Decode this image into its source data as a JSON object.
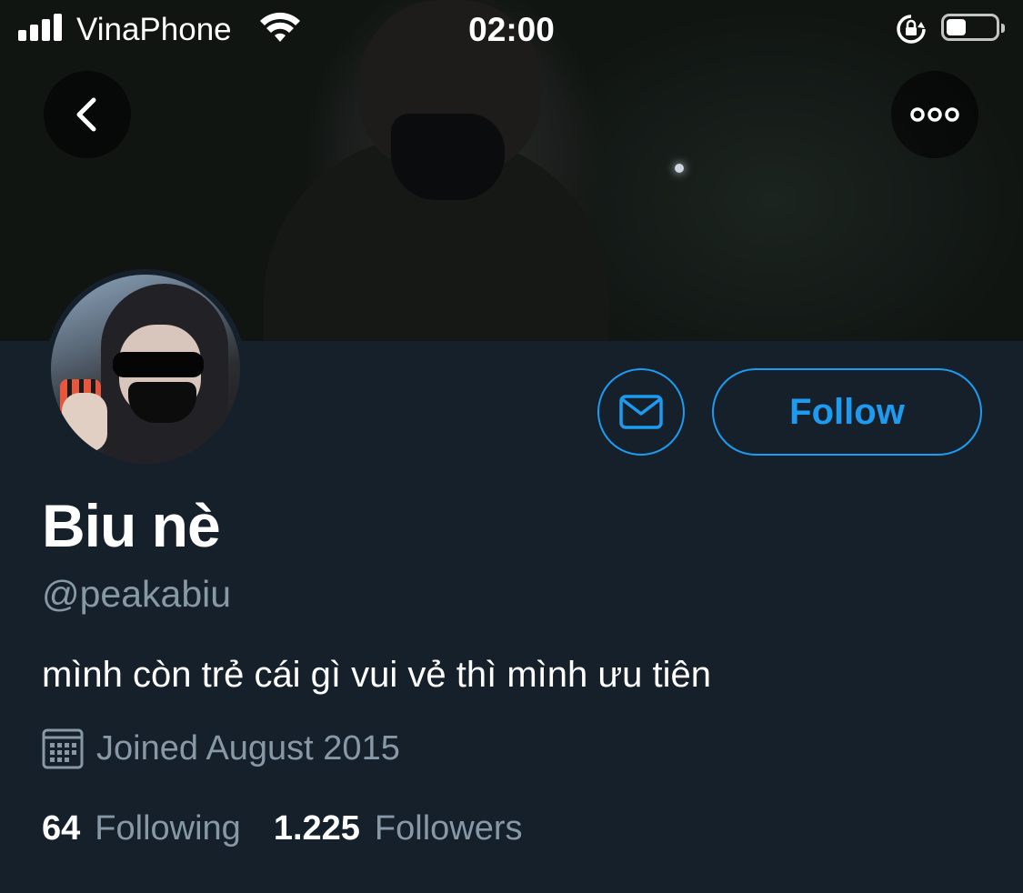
{
  "status_bar": {
    "carrier": "VinaPhone",
    "time": "02:00",
    "battery_level": 0.4
  },
  "header": {
    "back_icon": "chevron-left-icon",
    "more_icon": "more-horizontal-icon"
  },
  "profile": {
    "display_name": "Biu nè",
    "handle": "@peakabiu",
    "bio": "mình còn trẻ cái gì vui vẻ thì mình ưu tiên",
    "joined": "Joined August 2015",
    "following_count": "64",
    "following_label": "Following",
    "followers_count": "1.225",
    "followers_label": "Followers"
  },
  "actions": {
    "message_icon": "mail-icon",
    "follow_label": "Follow"
  },
  "colors": {
    "background": "#15202b",
    "accent": "#1d9bf0",
    "secondary_text": "#8899a6"
  }
}
